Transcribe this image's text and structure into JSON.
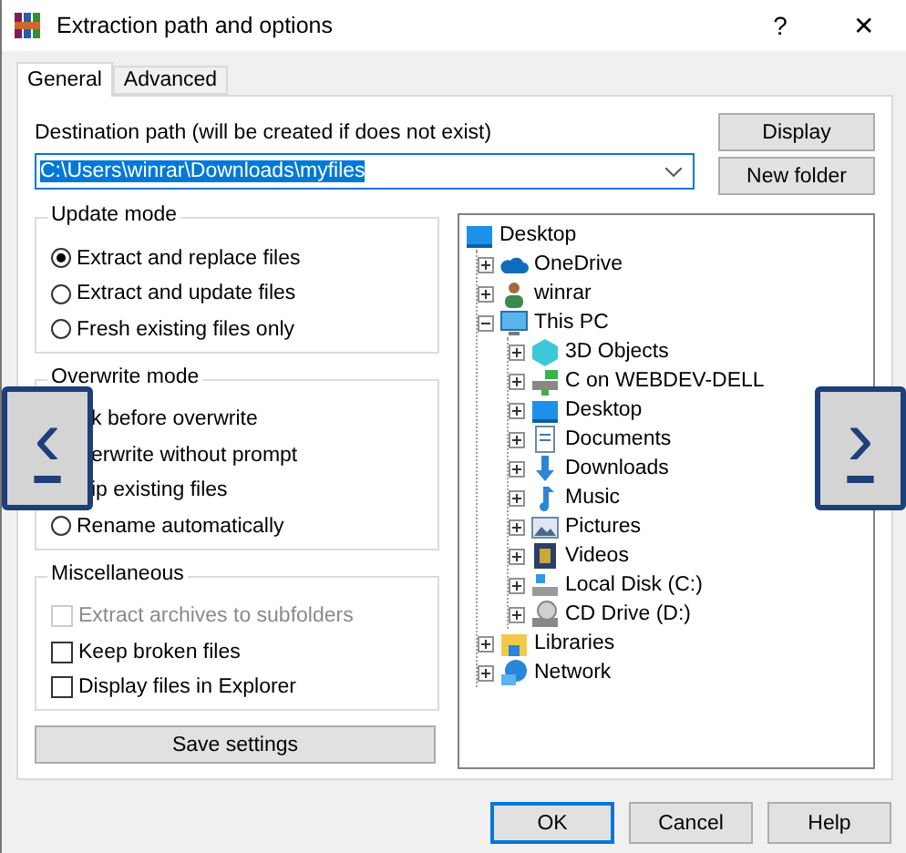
{
  "window": {
    "title": "Extraction path and options",
    "help": "?",
    "close": "✕"
  },
  "tabs": [
    {
      "label": "General",
      "selected": true
    },
    {
      "label": "Advanced",
      "selected": false
    }
  ],
  "destination": {
    "label": "Destination path (will be created if does not exist)",
    "value": "C:\\Users\\winrar\\Downloads\\myfiles"
  },
  "side_buttons": [
    "Display",
    "New folder"
  ],
  "update_mode": {
    "title": "Update mode",
    "options": [
      {
        "label": "Extract and replace files",
        "selected": true
      },
      {
        "label": "Extract and update files",
        "selected": false
      },
      {
        "label": "Fresh existing files only",
        "selected": false
      }
    ]
  },
  "overwrite_mode": {
    "title": "Overwrite mode",
    "options": [
      {
        "kind": "covered",
        "label": "k before overwrite"
      },
      {
        "kind": "covered",
        "label": "erwrite without prompt"
      },
      {
        "kind": "covered",
        "label": "ip existing files"
      },
      {
        "kind": "radio",
        "label": "Rename automatically",
        "selected": false
      }
    ]
  },
  "miscellaneous": {
    "title": "Miscellaneous",
    "options": [
      {
        "label": "Extract archives to subfolders",
        "checked": false,
        "disabled": true
      },
      {
        "label": "Keep broken files",
        "checked": false,
        "disabled": false
      },
      {
        "label": "Display files in Explorer",
        "checked": false,
        "disabled": false
      }
    ]
  },
  "save_button": "Save settings",
  "tree": [
    {
      "label": "Desktop",
      "children": [
        {
          "label": "OneDrive",
          "expanded": false
        },
        {
          "label": "winrar",
          "expanded": false
        },
        {
          "label": "This PC",
          "expanded": true,
          "children": [
            {
              "label": "3D Objects",
              "expanded": false
            },
            {
              "label": "C on WEBDEV-DELL",
              "expanded": false
            },
            {
              "label": "Desktop",
              "expanded": false
            },
            {
              "label": "Documents",
              "expanded": false
            },
            {
              "label": "Downloads",
              "expanded": false
            },
            {
              "label": "Music",
              "expanded": false
            },
            {
              "label": "Pictures",
              "expanded": false
            },
            {
              "label": "Videos",
              "expanded": false
            },
            {
              "label": "Local Disk (C:)",
              "expanded": false
            },
            {
              "label": "CD Drive (D:)",
              "expanded": false
            }
          ]
        },
        {
          "label": "Libraries",
          "expanded": false
        },
        {
          "label": "Network",
          "expanded": false
        }
      ]
    }
  ],
  "nav": {
    "previous": "‹",
    "next": "›"
  },
  "buttons": [
    "OK",
    "Cancel",
    "Help"
  ]
}
